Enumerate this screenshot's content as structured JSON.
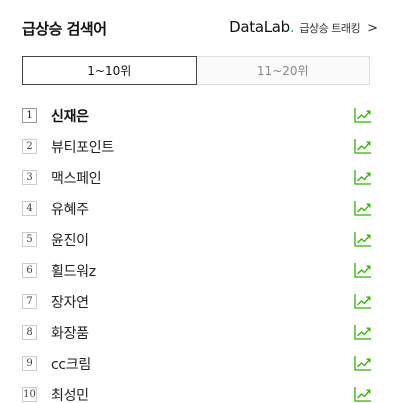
{
  "header": {
    "title": "급상승 검색어",
    "brand_main": "DataLab",
    "brand_dot": ".",
    "brand_sub": "급상승 트래킹",
    "arrow": ">"
  },
  "tabs": [
    {
      "label": "1~10위",
      "active": true
    },
    {
      "label": "11~20위",
      "active": false
    }
  ],
  "keywords": [
    {
      "rank": "1",
      "text": "신재은"
    },
    {
      "rank": "2",
      "text": "뷰티포인트"
    },
    {
      "rank": "3",
      "text": "맥스페인"
    },
    {
      "rank": "4",
      "text": "유혜주"
    },
    {
      "rank": "5",
      "text": "윤진이"
    },
    {
      "rank": "6",
      "text": "휠드워z"
    },
    {
      "rank": "7",
      "text": "장자연"
    },
    {
      "rank": "8",
      "text": "화장품"
    },
    {
      "rank": "9",
      "text": "cc크림"
    },
    {
      "rank": "10",
      "text": "최성민"
    }
  ],
  "colors": {
    "accent": "#03c75a",
    "trend_icon": "#2db400"
  },
  "icons": {
    "trend": "trend-up-chart-icon",
    "chevron": "chevron-right-icon"
  }
}
